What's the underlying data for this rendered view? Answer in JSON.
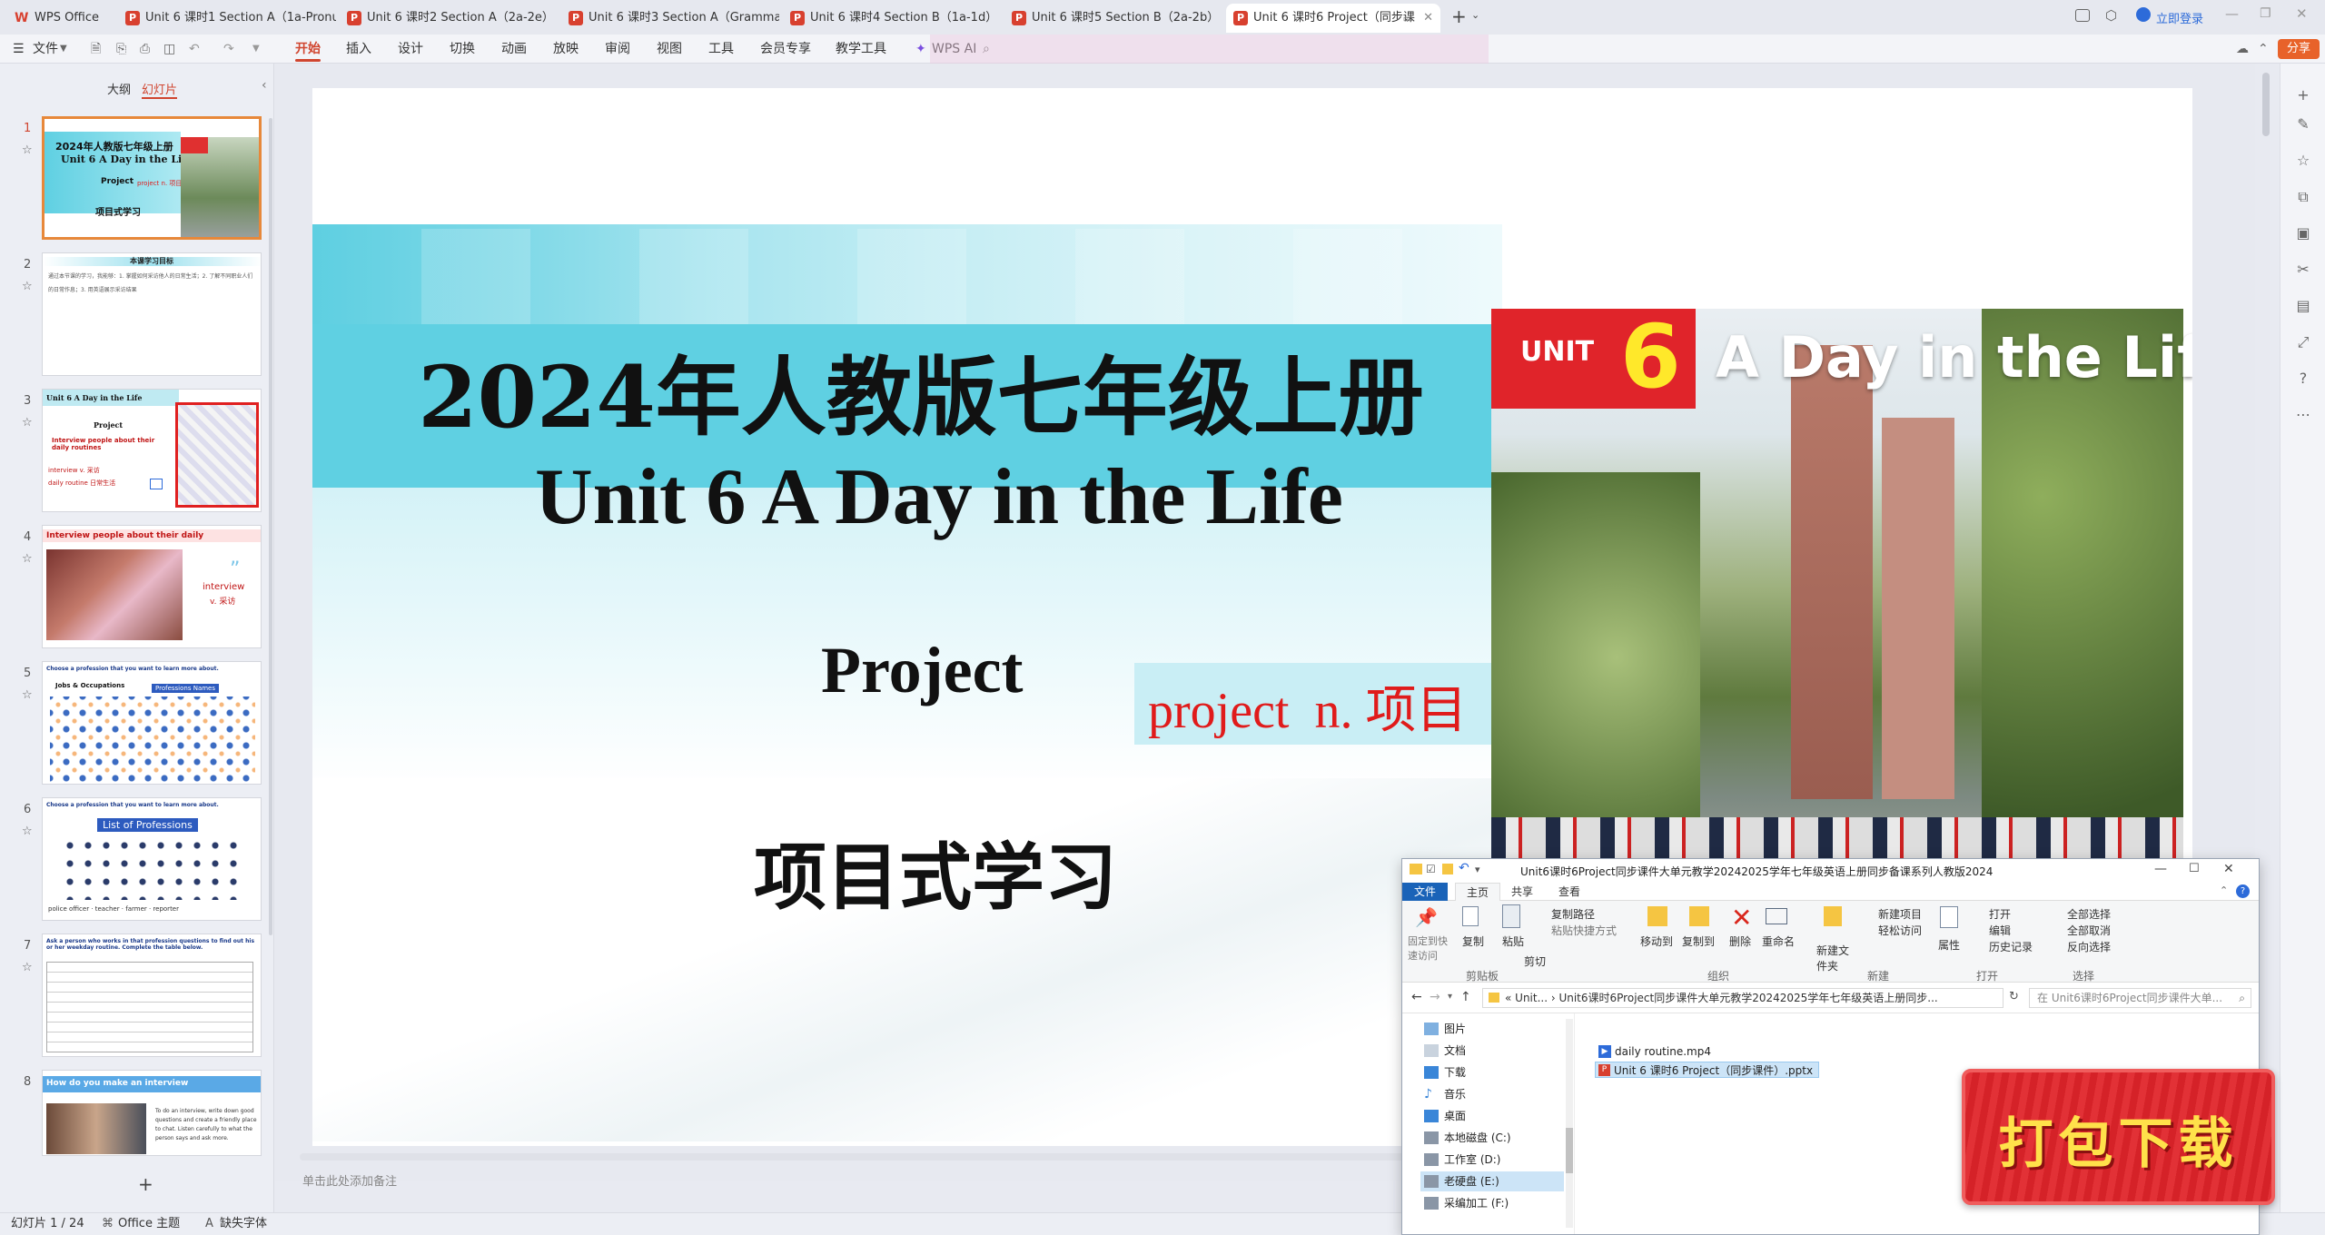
{
  "app": {
    "name": "WPS Office"
  },
  "tabs": [
    {
      "label": "Unit 6 课时1 Section A（1a-Pronun",
      "x": 0
    },
    {
      "label": "Unit 6 课时2 Section A（2a-2e）",
      "x": 0
    },
    {
      "label": "Unit 6 课时3 Section A（Grammar",
      "x": 0
    },
    {
      "label": "Unit 6 课时4 Section B（1a-1d）",
      "x": 0
    },
    {
      "label": "Unit 6 课时5 Section B（2a-2b）",
      "x": 0
    },
    {
      "label": "Unit 6 课时6 Project（同步课",
      "x": 0
    }
  ],
  "titlebar_right": {
    "login": "立即登录"
  },
  "menus": {
    "file": "文件",
    "items": [
      "开始",
      "插入",
      "设计",
      "切换",
      "动画",
      "放映",
      "审阅",
      "视图",
      "工具",
      "会员专享",
      "教学工具"
    ],
    "wps_ai": "WPS AI",
    "share": "分享"
  },
  "left_panel": {
    "tab_outline": "大纲",
    "tab_slides": "幻灯片",
    "slides": [
      {
        "num": "1",
        "title": "2024年人教版七年级上册",
        "sub": "Unit 6 A Day in the Life",
        "extra": "Project",
        "extra2": "项目式学习",
        "extra3": "project n. 项目"
      },
      {
        "num": "2",
        "title": "本课学习目标",
        "body": "通过本节课的学习，我能够：1. 掌握如何采访他人的日常生活；2. 了解不同职业人们的日常作息；3. 用英语展示采访结果"
      },
      {
        "num": "3",
        "title": "Unit 6 A Day in the Life",
        "sub": "Project",
        "extra": "Interview people about their daily routines",
        "extra2": "interview v. 采访",
        "extra3": "daily routine 日常生活"
      },
      {
        "num": "4",
        "title": "Interview people about their daily",
        "extra": "interview",
        "extra2": "v. 采访"
      },
      {
        "num": "5",
        "title": "Choose a profession that you want to learn more about.",
        "extra": "Jobs & Occupations",
        "extra2": "Professions Names"
      },
      {
        "num": "6",
        "title": "Choose a profession that you want to learn more about.",
        "extra": "List of Professions",
        "extra2": "police officer · teacher · farmer · reporter"
      },
      {
        "num": "7",
        "title": "Ask a person who works in that profession questions to find out his or her weekday routine. Complete the table below."
      },
      {
        "num": "8",
        "title": "How do you make an interview",
        "extra": "To do an interview, write down good questions and create a friendly place to chat. Listen carefully to what the person says and ask more."
      }
    ],
    "add_label": "+"
  },
  "slide": {
    "title_cn": "2024年人教版七年级上册",
    "title_en": "Unit 6 A Day in the Life",
    "project": "Project",
    "project_gloss": "project  n. 项目",
    "subtitle_cn": "项目式学习",
    "banner_unit": "UNIT",
    "banner_num": "6",
    "banner_title": "A Day in the Life"
  },
  "notes_placeholder": "单击此处添加备注",
  "status": {
    "slide_counter": "幻灯片 1 / 24",
    "theme": "Office 主题",
    "missing_font": "缺失字体"
  },
  "explorer": {
    "title": "Unit6课时6Project同步课件大单元教学20242025学年七年级英语上册同步备课系列人教版2024",
    "ribbon_tabs": [
      "文件",
      "主页",
      "共享",
      "查看"
    ],
    "groups": {
      "clipboard": {
        "label": "剪贴板",
        "pin": "固定到快速访问",
        "copy": "复制",
        "paste": "粘贴",
        "copy_path": "复制路径",
        "paste_shortcut": "粘贴快捷方式",
        "cut": "剪切"
      },
      "organize": {
        "label": "组织",
        "move_to": "移动到",
        "copy_to": "复制到",
        "delete": "删除",
        "rename": "重命名"
      },
      "new": {
        "label": "新建",
        "new_folder": "新建文件夹",
        "new_item": "新建项目",
        "easy_access": "轻松访问"
      },
      "open": {
        "label": "打开",
        "properties": "属性",
        "open": "打开",
        "edit": "编辑",
        "history": "历史记录"
      },
      "select": {
        "label": "选择",
        "select_all": "全部选择",
        "select_none": "全部取消",
        "invert": "反向选择"
      }
    },
    "address": "«  Unit...  ›  Unit6课时6Project同步课件大单元教学20242025学年七年级英语上册同步...",
    "search_placeholder": "在 Unit6课时6Project同步课件大单...",
    "nav": [
      "图片",
      "文档",
      "下载",
      "音乐",
      "桌面",
      "本地磁盘 (C:)",
      "工作室 (D:)",
      "老硬盘 (E:)",
      "采编加工 (F:)"
    ],
    "files": [
      "daily routine.mp4",
      "Unit 6 课时6 Project（同步课件）.pptx"
    ]
  },
  "download_badge": "打包下载",
  "colors": {
    "accent": "#d0452f",
    "slide_cyan": "#5bcde0",
    "badge_red": "#e0242a",
    "gloss_red": "#e01b1b"
  }
}
